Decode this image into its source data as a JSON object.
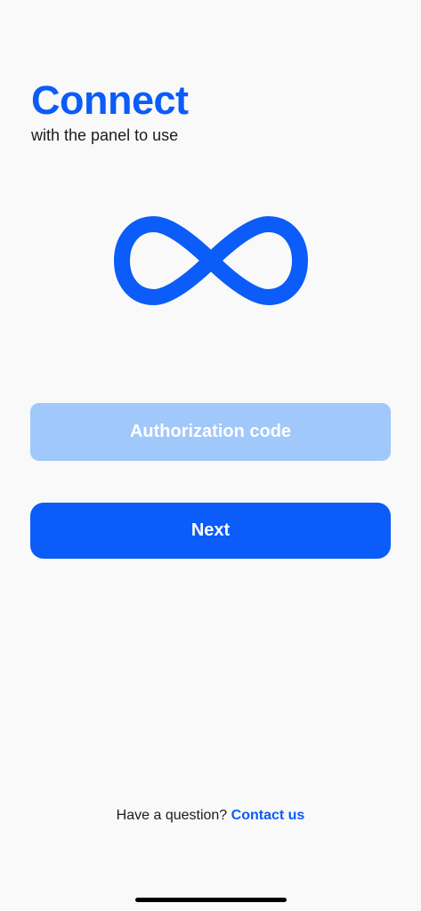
{
  "header": {
    "title": "Connect",
    "subtitle": "with the panel to use"
  },
  "logo": {
    "icon": "infinity-icon",
    "color": "#0b5cf8"
  },
  "auth_field": {
    "placeholder": "Authorization code",
    "value": ""
  },
  "next_button": {
    "label": "Next"
  },
  "footer": {
    "question": "Have a question?",
    "contact_label": "Contact us"
  },
  "colors": {
    "accent": "#0b5cf8",
    "field_background": "#a1c8fa",
    "background": "#f9f9f9"
  }
}
